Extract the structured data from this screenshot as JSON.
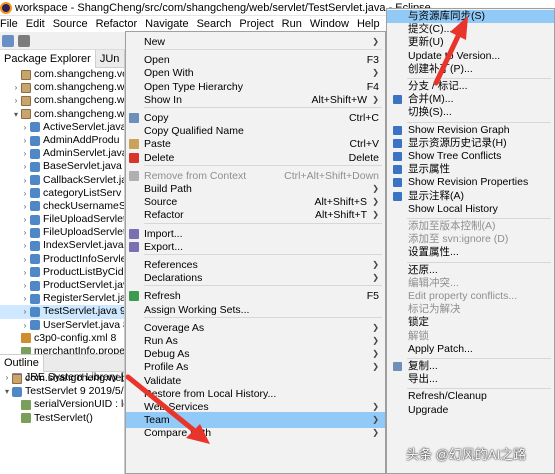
{
  "window": {
    "title": "workspace - ShangCheng/src/com/shangcheng/web/servlet/TestServlet.java - Eclipse"
  },
  "menubar": [
    "File",
    "Edit",
    "Source",
    "Refactor",
    "Navigate",
    "Search",
    "Project",
    "Run",
    "Window",
    "Help"
  ],
  "left_panel": {
    "tabs": [
      "Package Explorer",
      "JUn"
    ],
    "tree": [
      {
        "label": "com.shangcheng.vo",
        "indent": 1,
        "arrow": "",
        "icon": "pkg"
      },
      {
        "label": "com.shangcheng.w",
        "indent": 1,
        "arrow": ">",
        "icon": "pkg"
      },
      {
        "label": "com.shangcheng.w",
        "indent": 1,
        "arrow": ">",
        "icon": "pkg"
      },
      {
        "label": "com.shangcheng.w",
        "indent": 1,
        "arrow": "v",
        "icon": "pkg"
      },
      {
        "label": "ActiveServlet.java",
        "indent": 2,
        "arrow": ">",
        "icon": "java"
      },
      {
        "label": "AdminAddProdu",
        "indent": 2,
        "arrow": ">",
        "icon": "java"
      },
      {
        "label": "AdminServlet.java",
        "indent": 2,
        "arrow": ">",
        "icon": "java"
      },
      {
        "label": "BaseServlet.java 8",
        "indent": 2,
        "arrow": ">",
        "icon": "java"
      },
      {
        "label": "CallbackServlet.ja",
        "indent": 2,
        "arrow": ">",
        "icon": "java"
      },
      {
        "label": "categoryListServ",
        "indent": 2,
        "arrow": ">",
        "icon": "java"
      },
      {
        "label": "checkUsernameS",
        "indent": 2,
        "arrow": ">",
        "icon": "java"
      },
      {
        "label": "FileUploadServlet",
        "indent": 2,
        "arrow": ">",
        "icon": "java"
      },
      {
        "label": "FileUploadServlet",
        "indent": 2,
        "arrow": ">",
        "icon": "java"
      },
      {
        "label": "IndexServlet.java",
        "indent": 2,
        "arrow": ">",
        "icon": "java"
      },
      {
        "label": "ProductInfoServle",
        "indent": 2,
        "arrow": ">",
        "icon": "java"
      },
      {
        "label": "ProductListByCid",
        "indent": 2,
        "arrow": ">",
        "icon": "java"
      },
      {
        "label": "ProductServlet.jav",
        "indent": 2,
        "arrow": ">",
        "icon": "java"
      },
      {
        "label": "RegisterServlet.ja",
        "indent": 2,
        "arrow": ">",
        "icon": "java"
      },
      {
        "label": "TestServlet.java 9",
        "indent": 2,
        "arrow": ">",
        "icon": "java",
        "selected": true
      },
      {
        "label": "UserServlet.java 8",
        "indent": 2,
        "arrow": ">",
        "icon": "java"
      },
      {
        "label": "c3p0-config.xml 8",
        "indent": 1,
        "arrow": "",
        "icon": "xml"
      },
      {
        "label": "merchantInfo.prope",
        "indent": 1,
        "arrow": "",
        "icon": "props"
      },
      {
        "label": "redis.properties 8",
        "indent": 1,
        "arrow": "",
        "icon": "props"
      },
      {
        "label": "JRE System Library [Ja",
        "indent": 0,
        "arrow": ">",
        "icon": "lib"
      }
    ],
    "outline_tab": "Outline",
    "outline": [
      {
        "label": "com.shangcheng.web.",
        "indent": 0,
        "arrow": "",
        "icon": "pkg"
      },
      {
        "label": "TestServlet 9  2019/5/",
        "indent": 0,
        "arrow": "v",
        "icon": "java"
      },
      {
        "label": "serialVersionUID : lo",
        "indent": 1,
        "arrow": "",
        "icon": "props"
      },
      {
        "label": "TestServlet()",
        "indent": 1,
        "arrow": "",
        "icon": "props"
      }
    ]
  },
  "editor_tab": "TestS",
  "context_menu": {
    "items": [
      {
        "label": "New",
        "submenu": true
      },
      {
        "sep": true
      },
      {
        "label": "Open",
        "shortcut": "F3"
      },
      {
        "label": "Open With",
        "submenu": true
      },
      {
        "label": "Open Type Hierarchy",
        "shortcut": "F4"
      },
      {
        "label": "Show In",
        "shortcut": "Alt+Shift+W",
        "submenu": true
      },
      {
        "sep": true
      },
      {
        "label": "Copy",
        "shortcut": "Ctrl+C",
        "icon": "copy-icon"
      },
      {
        "label": "Copy Qualified Name"
      },
      {
        "label": "Paste",
        "shortcut": "Ctrl+V",
        "icon": "paste-icon"
      },
      {
        "label": "Delete",
        "shortcut": "Delete",
        "icon": "delete-icon"
      },
      {
        "sep": true
      },
      {
        "label": "Remove from Context",
        "shortcut": "Ctrl+Alt+Shift+Down",
        "disabled": true,
        "icon": "remove-context-icon"
      },
      {
        "label": "Build Path",
        "submenu": true
      },
      {
        "label": "Source",
        "shortcut": "Alt+Shift+S",
        "submenu": true
      },
      {
        "label": "Refactor",
        "shortcut": "Alt+Shift+T",
        "submenu": true
      },
      {
        "sep": true
      },
      {
        "label": "Import...",
        "icon": "import-icon"
      },
      {
        "label": "Export...",
        "icon": "export-icon"
      },
      {
        "sep": true
      },
      {
        "label": "References",
        "submenu": true
      },
      {
        "label": "Declarations",
        "submenu": true
      },
      {
        "sep": true
      },
      {
        "label": "Refresh",
        "shortcut": "F5",
        "icon": "refresh-icon"
      },
      {
        "label": "Assign Working Sets..."
      },
      {
        "sep": true
      },
      {
        "label": "Coverage As",
        "submenu": true
      },
      {
        "label": "Run As",
        "submenu": true
      },
      {
        "label": "Debug As",
        "submenu": true
      },
      {
        "label": "Profile As",
        "submenu": true
      },
      {
        "label": "Validate"
      },
      {
        "label": "Restore from Local History..."
      },
      {
        "label": "Web Services",
        "submenu": true
      },
      {
        "label": "Team",
        "submenu": true,
        "highlighted": true
      },
      {
        "label": "Compare With",
        "submenu": true
      }
    ]
  },
  "team_submenu": {
    "items": [
      {
        "label": "与资源库同步(S)",
        "highlighted": true
      },
      {
        "label": "提交(C)..."
      },
      {
        "label": "更新(U)"
      },
      {
        "label": "Update to Version..."
      },
      {
        "label": "创建补丁(P)..."
      },
      {
        "sep": true
      },
      {
        "label": "分支 / 标记..."
      },
      {
        "label": "合并(M)...",
        "icon": "merge-icon"
      },
      {
        "label": "切换(S)..."
      },
      {
        "sep": true
      },
      {
        "label": "Show Revision Graph",
        "icon": "revision-graph-icon"
      },
      {
        "label": "显示资源历史记录(H)",
        "icon": "history-icon"
      },
      {
        "label": "Show Tree Conflicts",
        "icon": "tree-conflicts-icon"
      },
      {
        "label": "显示属性",
        "icon": "properties-icon"
      },
      {
        "label": "Show Revision Properties",
        "icon": "revision-properties-icon"
      },
      {
        "label": "显示注释(A)",
        "icon": "annotation-icon"
      },
      {
        "label": "Show Local History"
      },
      {
        "sep": true
      },
      {
        "label": "添加至版本控制(A)",
        "disabled": true
      },
      {
        "label": "添加至 svn:ignore (D)",
        "disabled": true
      },
      {
        "label": "设置属性..."
      },
      {
        "sep": true
      },
      {
        "label": "还原..."
      },
      {
        "label": "编辑冲突...",
        "disabled": true
      },
      {
        "label": "Edit property conflicts...",
        "disabled": true
      },
      {
        "label": "标记为解决",
        "disabled": true
      },
      {
        "label": "锁定"
      },
      {
        "label": "解锁",
        "disabled": true
      },
      {
        "label": "Apply Patch..."
      },
      {
        "sep": true
      },
      {
        "label": "复制...",
        "icon": "copy-icon"
      },
      {
        "label": "导出..."
      },
      {
        "sep": true
      },
      {
        "label": "Refresh/Cleanup"
      },
      {
        "label": "Upgrade"
      }
    ]
  },
  "watermark": "头条 @幻风的AI之路",
  "colors": {
    "highlight": "#91c9f7",
    "menu_bg": "#f2f2f2",
    "arrow": "#e8342a"
  }
}
